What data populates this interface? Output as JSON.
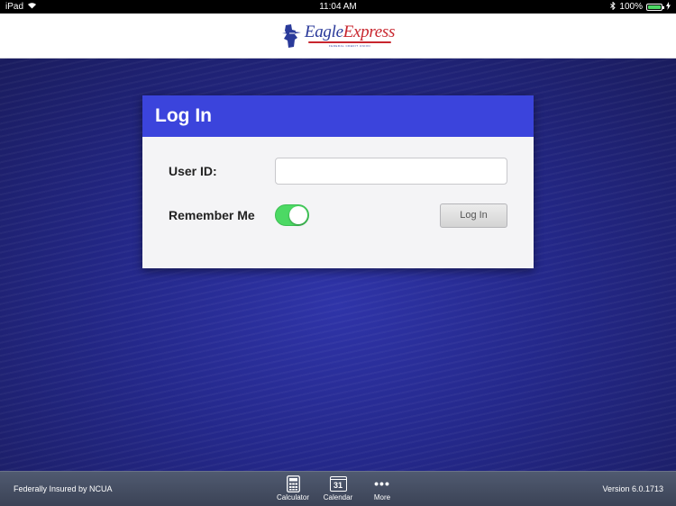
{
  "status_bar": {
    "device": "iPad",
    "time": "11:04 AM",
    "battery": "100%",
    "battery_level": 1.0
  },
  "header": {
    "logo_text_eagle": "Eagle",
    "logo_text_express": "Express",
    "logo_sub": "FEDERAL CREDIT UNION"
  },
  "login": {
    "title": "Log In",
    "user_id_label": "User ID:",
    "user_id_value": "",
    "remember_me_label": "Remember Me",
    "remember_me_on": true,
    "login_button_label": "Log In"
  },
  "footer": {
    "insured_text": "Federally Insured by NCUA",
    "version_text": "Version 6.0.1713",
    "tabs": [
      {
        "label": "Calculator",
        "icon": "calculator-icon"
      },
      {
        "label": "Calendar",
        "icon": "calendar-icon",
        "day": "31"
      },
      {
        "label": "More",
        "icon": "more-icon"
      }
    ]
  },
  "colors": {
    "header_blue": "#3b44dc",
    "background_blue": "#24288a",
    "toggle_green": "#4cd964",
    "logo_red": "#c8262e",
    "logo_blue": "#2a3a9a"
  }
}
